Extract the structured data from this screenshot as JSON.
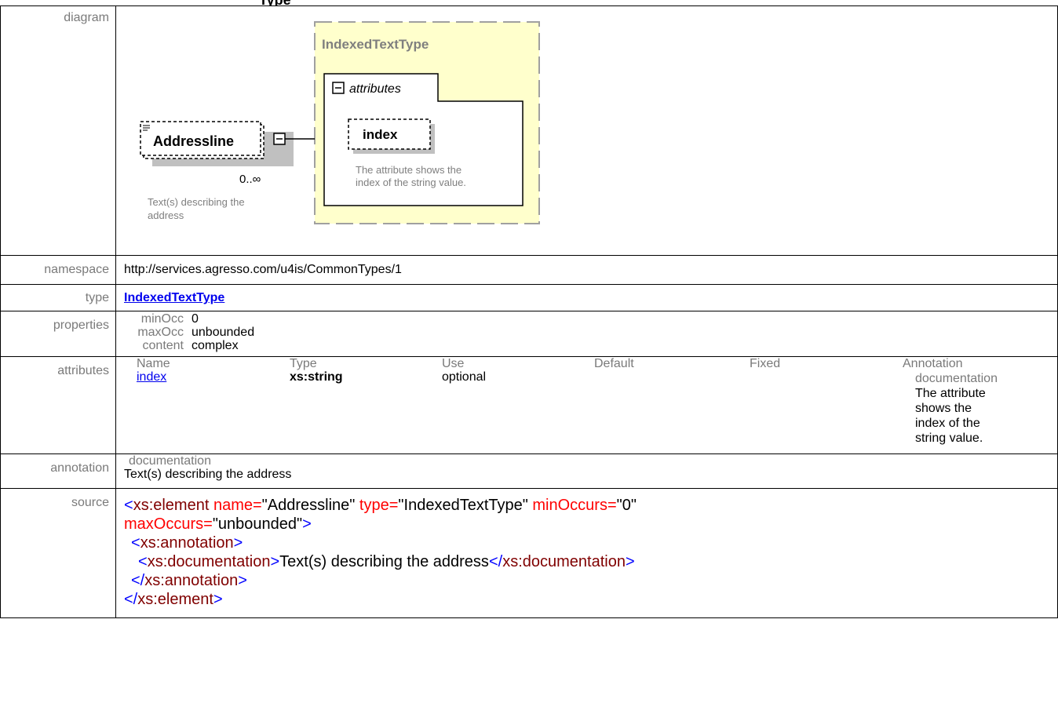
{
  "header": {
    "partial_title": "Type"
  },
  "labels": {
    "diagram": "diagram",
    "namespace": "namespace",
    "type": "type",
    "properties": "properties",
    "attributes": "attributes",
    "annotation": "annotation",
    "source": "source"
  },
  "diagram": {
    "element_name": "Addressline",
    "cardinality": "0..∞",
    "element_doc_line1": "Text(s) describing the",
    "element_doc_line2": "address",
    "type_name": "IndexedTextType",
    "attributes_label": "attributes",
    "attribute_name": "index",
    "attribute_doc_line1": "The attribute shows the",
    "attribute_doc_line2": "index of the string value.",
    "colors": {
      "type_fill": "#ffffcc",
      "type_border": "#a0a0a0",
      "type_title": "#7f7f7f"
    }
  },
  "namespace": "http://services.agresso.com/u4is/CommonTypes/1",
  "type_link": "IndexedTextType",
  "properties": [
    {
      "key": "minOcc",
      "value": "0"
    },
    {
      "key": "maxOcc",
      "value": "unbounded"
    },
    {
      "key": "content",
      "value": "complex"
    }
  ],
  "attributes_table": {
    "headers": [
      "Name",
      "Type",
      "Use",
      "Default",
      "Fixed",
      "Annotation"
    ],
    "row": {
      "name": "index",
      "type": "xs:string",
      "use": "optional",
      "default": "",
      "fixed": "",
      "annotation_key": "documentation",
      "annotation_lines": [
        "The attribute",
        "shows the",
        "index of the",
        "string value."
      ]
    }
  },
  "annotation": {
    "key": "documentation",
    "value": "Text(s) describing the address"
  },
  "source": {
    "l1": {
      "open": "<",
      "tag": "xs:element",
      "a1": " name=",
      "v1": "\"Addressline\"",
      "a2": " type=",
      "v2": "\"IndexedTextType\"",
      "a3": " minOccurs=",
      "v3": "\"0\""
    },
    "l2": {
      "a4": "maxOccurs=",
      "v4": "\"unbounded\"",
      "close": ">"
    },
    "l3": {
      "open": "<",
      "tag": "xs:annotation",
      "close": ">"
    },
    "l4": {
      "open": "<",
      "tag": "xs:documentation",
      "close": ">",
      "text": "Text(s) describing the address",
      "open2": "</",
      "tag2": "xs:documentation",
      "close2": ">"
    },
    "l5": {
      "open": "</",
      "tag": "xs:annotation",
      "close": ">"
    },
    "l6": {
      "open": "</",
      "tag": "xs:element",
      "close": ">"
    }
  }
}
